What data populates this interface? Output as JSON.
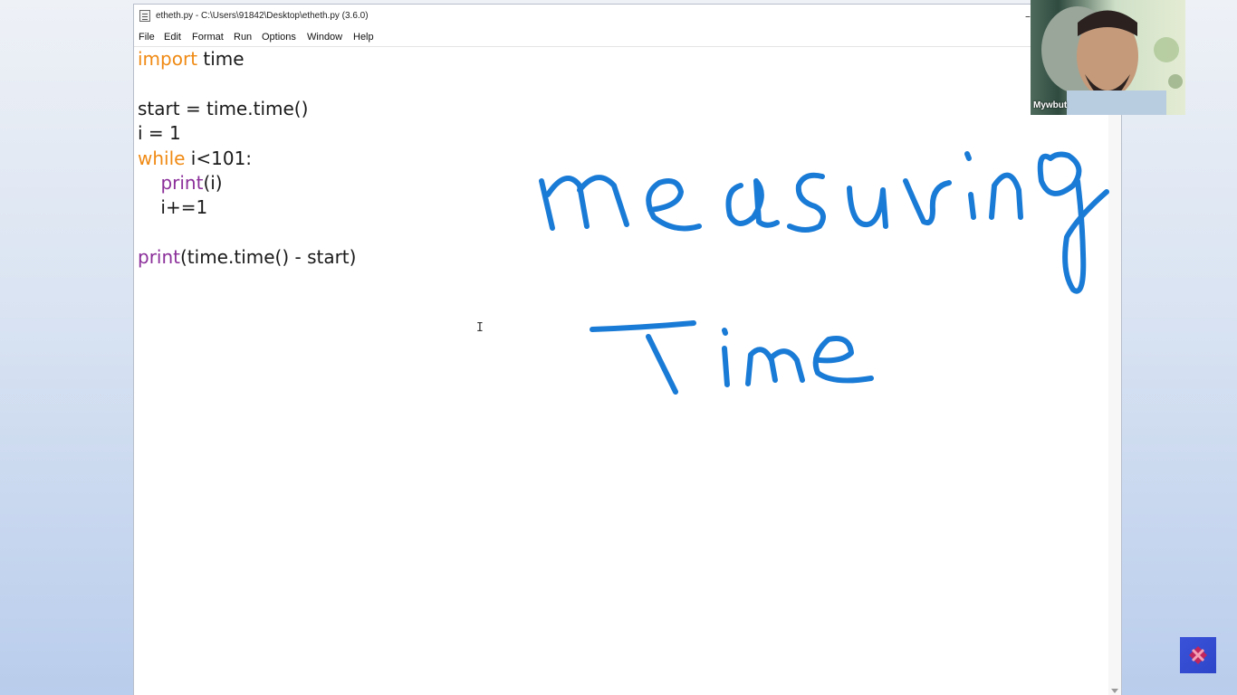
{
  "window": {
    "title": "etheth.py - C:\\Users\\91842\\Desktop\\etheth.py (3.6.0)",
    "minimize_glyph": "–"
  },
  "menu": [
    "File",
    "Edit",
    "Format",
    "Run",
    "Options",
    "Window",
    "Help"
  ],
  "code": {
    "l1_kw": "import",
    "l1_rest": " time",
    "l3": "start = time.time()",
    "l4": "i = 1",
    "l5_kw": "while",
    "l5_rest": " i<101:",
    "l6_indent": "    ",
    "l6_bi": "print",
    "l6_rest": "(i)",
    "l7": "    i+=1",
    "l9_bi": "print",
    "l9_rest": "(time.time() - start)"
  },
  "text_cursor": "I",
  "handwriting": {
    "line1": "measuring",
    "line2": "Time",
    "color": "#1a7bd6"
  },
  "webcam": {
    "label": "Mywbut"
  },
  "colors": {
    "keyword": "#f08a14",
    "builtin": "#8b2f9a",
    "text": "#1a1a1a"
  }
}
